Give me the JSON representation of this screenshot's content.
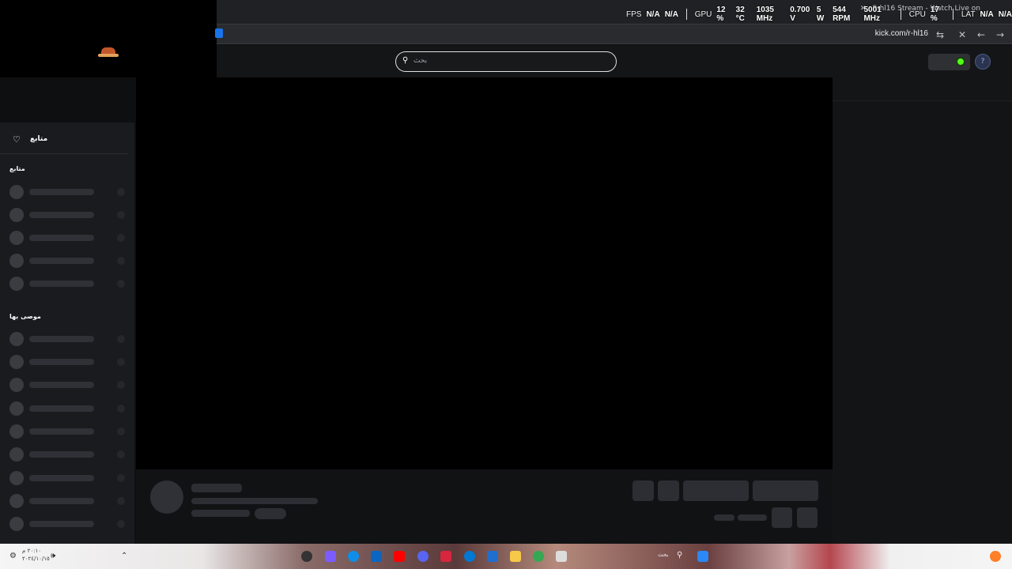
{
  "overlay": {
    "fps_label": "FPS",
    "fps_value1": "N/A",
    "fps_value2": "N/A",
    "gpu_label": "GPU",
    "gpu_usage": "12 %",
    "gpu_temp": "32 °C",
    "gpu_clock": "1035 MHz",
    "gpu_volt": "0.700 V",
    "gpu_power": "5 W",
    "gpu_fan": "544 RPM",
    "gpu_mem": "5001 MHz",
    "cpu_label": "CPU",
    "cpu_usage": "17 %",
    "lat_label": "LAT",
    "lat_value1": "N/A",
    "lat_value2": "N/A"
  },
  "browser": {
    "tab_title": "R-hl16 Stream - Watch Live on",
    "url": "kick.com/r-hl16"
  },
  "header": {
    "search_placeholder": "بحث",
    "search_icon": "search-icon"
  },
  "sidebar": {
    "following_label": "متابع",
    "section_following": "متابع",
    "section_recommended": "موصى بها"
  },
  "taskbar": {
    "search_placeholder": "بحث",
    "clock": "٢٠:١٠ م",
    "date": "٢٠٢٤/١٠/١٥"
  },
  "colors": {
    "kick_green": "#53fc18",
    "background": "#0e0f10",
    "sidebar": "#191b1f"
  }
}
